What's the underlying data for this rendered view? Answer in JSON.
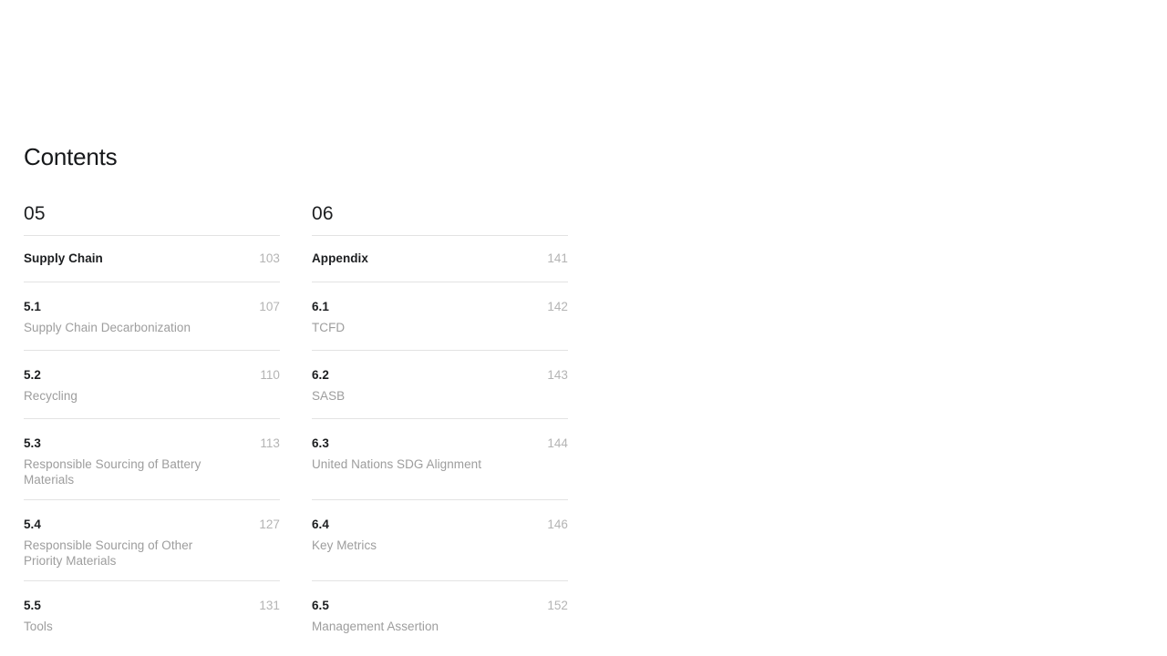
{
  "page": {
    "title": "Contents",
    "background_color": "#ffffff",
    "text_color": "#1c1e20",
    "muted_text_color": "#9d9d9d",
    "page_number_color": "#b4b4b4",
    "divider_color": "#e3e3e3"
  },
  "columns": [
    {
      "section_number": "05",
      "rows": [
        {
          "label": "Supply Chain",
          "page": "103",
          "description": ""
        },
        {
          "label": "5.1",
          "page": "107",
          "description": "Supply Chain Decarbonization"
        },
        {
          "label": "5.2",
          "page": "110",
          "description": "Recycling"
        },
        {
          "label": "5.3",
          "page": "113",
          "description": "Responsible Sourcing of Battery Materials"
        },
        {
          "label": "5.4",
          "page": "127",
          "description": "Responsible Sourcing of Other Priority Materials"
        },
        {
          "label": "5.5",
          "page": "131",
          "description": "Tools"
        }
      ]
    },
    {
      "section_number": "06",
      "rows": [
        {
          "label": "Appendix",
          "page": "141",
          "description": ""
        },
        {
          "label": "6.1",
          "page": "142",
          "description": "TCFD"
        },
        {
          "label": "6.2",
          "page": "143",
          "description": "SASB"
        },
        {
          "label": "6.3",
          "page": "144",
          "description": "United Nations SDG Alignment"
        },
        {
          "label": "6.4",
          "page": "146",
          "description": "Key Metrics"
        },
        {
          "label": "6.5",
          "page": "152",
          "description": "Management Assertion"
        }
      ]
    }
  ]
}
